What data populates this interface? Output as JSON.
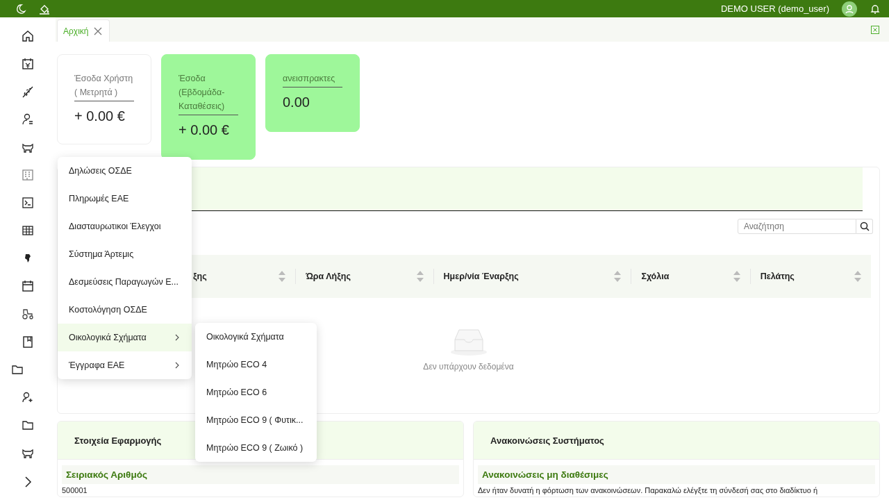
{
  "top_bar": {
    "user": "DEMO USER (demo_user)"
  },
  "tabs": [
    {
      "label": "Αρχική",
      "selected": true
    }
  ],
  "cards": [
    {
      "label": "Έσοδα Χρήστη ( Μετρητά )",
      "value": "+ 0.00 €",
      "highlight": false
    },
    {
      "label": "Έσοδα (Εβδομάδα-Καταθέσεις)",
      "value": "+ 0.00 €",
      "highlight": true
    },
    {
      "label": "ανεισπρακτες",
      "value": "0.00",
      "highlight": true
    }
  ],
  "table": {
    "search": {
      "placeholder": "Αναζήτηση"
    },
    "columns": [
      "ξης",
      "Ώρα Λήξης",
      "Ημερ/νία Έναρξης",
      "Σχόλια",
      "Πελάτης"
    ],
    "empty_text": "Δεν υπάρχουν δεδομένα"
  },
  "app_info": {
    "title": "Στοιχεία Εφαρμογής",
    "field_label": "Σειριακός Αριθμός",
    "field_value": "500001"
  },
  "announcements": {
    "title": "Ανακοινώσεις Συστήματος",
    "heading": "Ανακοινώσεις μη διαθέσιμες",
    "text": "Δεν ήταν δυνατή η φόρτωση των ανακοινώσεων. Παρακαλώ ελέγξτε τη σύνδεσή σας στο διαδίκτυο ή"
  },
  "menu": {
    "items": [
      {
        "label": "Δηλώσεις ΟΣΔΕ",
        "selected": false,
        "has_submenu": false
      },
      {
        "label": "Πληρωμές ΕΑΕ",
        "selected": false,
        "has_submenu": false
      },
      {
        "label": "Διασταυρωτικοι Έλεγχοι",
        "selected": false,
        "has_submenu": false
      },
      {
        "label": "Σύστημα Άρτεμις",
        "selected": false,
        "has_submenu": false
      },
      {
        "label": "Δεσμεύσεις Παραγωγών Ε...",
        "selected": false,
        "has_submenu": false
      },
      {
        "label": "Κοστολόγηση ΟΣΔΕ",
        "selected": false,
        "has_submenu": false
      },
      {
        "label": "Οικολογικά Σχήματα",
        "selected": true,
        "has_submenu": true
      },
      {
        "label": "Έγγραφα ΕΑΕ",
        "selected": false,
        "has_submenu": true
      }
    ],
    "submenu": [
      "Οικολογικά Σχήματα",
      "Μητρώο ECO 4",
      "Μητρώο ECO 6",
      "Μητρώο ECO 9 ( Φυτικ...",
      "Μητρώο ECO 9 ( Ζωικό )"
    ]
  }
}
